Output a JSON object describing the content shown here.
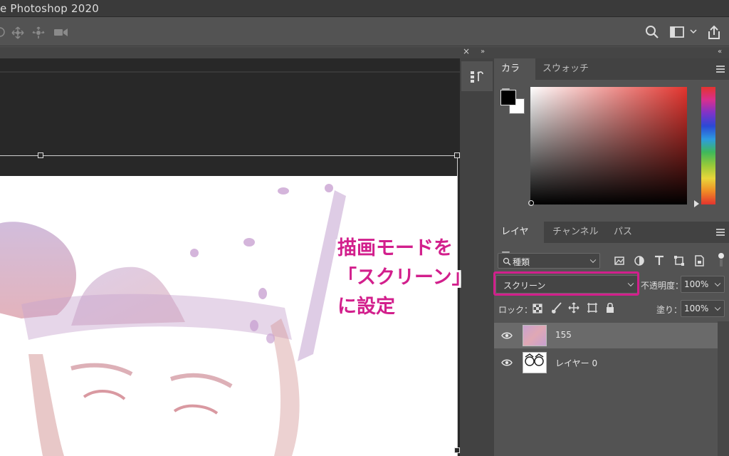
{
  "window": {
    "title": "e Photoshop 2020"
  },
  "options_bar": {
    "icons": [
      "orbit-3d-icon",
      "pan-3d-icon",
      "slide-3d-icon",
      "video-camera-icon"
    ],
    "right_icons": [
      "search-icon",
      "workspace-icon",
      "chevron-down-icon",
      "share-icon"
    ]
  },
  "panel_strip": {
    "close": "×",
    "collapse_left": "»",
    "collapse_right": "«"
  },
  "color_panel": {
    "tabs": [
      "カラー",
      "スウォッチ"
    ],
    "active_tab": "カラー",
    "foreground": "#000000",
    "background": "#ffffff",
    "hue": "#e3342e"
  },
  "layers_panel": {
    "tabs": [
      "レイヤー",
      "チャンネル",
      "パス"
    ],
    "active_tab": "レイヤー",
    "filter_label": "種類",
    "blend_mode": "スクリーン",
    "opacity_label": "不透明度：",
    "opacity_value": "100%",
    "lock_label": "ロック：",
    "fill_label": "塗り：",
    "fill_value": "100%",
    "layers": [
      {
        "name": "155",
        "selected": true
      },
      {
        "name": "レイヤー 0",
        "selected": false
      }
    ]
  },
  "annotation": {
    "lines": [
      "描画モードを",
      "「スクリーン」",
      "に設定"
    ],
    "color": "#d21f8c"
  }
}
